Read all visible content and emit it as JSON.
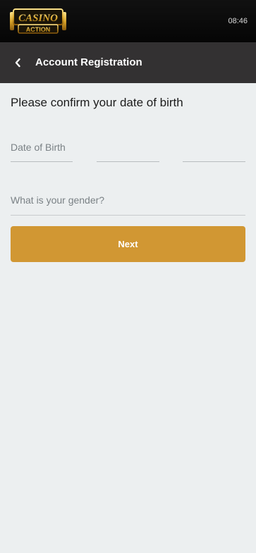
{
  "status_bar": {
    "time": "08:46"
  },
  "logo": {
    "line1": "CASINO",
    "line2": "ACTION"
  },
  "header": {
    "back_icon": "chevron-left-icon",
    "title": "Account Registration"
  },
  "form": {
    "heading": "Please confirm your date of birth",
    "dob_label": "Date of Birth",
    "gender_placeholder": "What is your gender?",
    "next_label": "Next"
  },
  "colors": {
    "accent": "#d19733",
    "header_bg": "#333132",
    "page_bg": "#eceff0",
    "topbar_bg": "#0a0a0a"
  }
}
